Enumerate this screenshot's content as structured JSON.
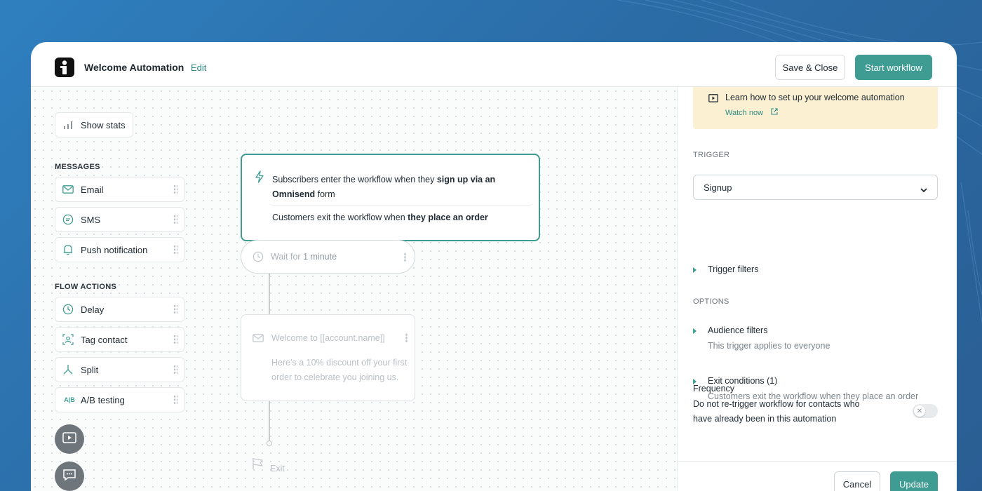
{
  "header": {
    "title": "Welcome Automation",
    "edit_label": "Edit",
    "save_close_label": "Save & Close",
    "start_workflow_label": "Start workflow"
  },
  "sidebar": {
    "show_stats_label": "Show stats",
    "messages_heading": "MESSAGES",
    "messages": [
      {
        "label": "Email",
        "icon": "mail-icon"
      },
      {
        "label": "SMS",
        "icon": "chat-icon"
      },
      {
        "label": "Push notification",
        "icon": "bell-icon"
      }
    ],
    "flow_actions_heading": "FLOW ACTIONS",
    "flow_actions": [
      {
        "label": "Delay",
        "icon": "clock-icon"
      },
      {
        "label": "Tag contact",
        "icon": "tag-contact-icon"
      },
      {
        "label": "Split",
        "icon": "split-icon"
      },
      {
        "label": "A/B testing",
        "icon": "ab-test-icon"
      }
    ]
  },
  "flow": {
    "trigger": {
      "enter_prefix": "Subscribers enter the workflow when they ",
      "enter_bold": "sign up via an Omnisend",
      "enter_suffix": "form",
      "exit_prefix": "Customers exit the workflow when ",
      "exit_bold": "they place an order"
    },
    "wait": {
      "prefix": "Wait for ",
      "value": "1 minute"
    },
    "email": {
      "title": "Welcome to [[account.name]]",
      "body": "Here's a 10% discount off your first order to celebrate you joining us."
    },
    "exit_label": "Exit"
  },
  "panel": {
    "learn_text": "Learn how to set up your welcome automation",
    "watch_label": "Watch now",
    "trigger_heading": "TRIGGER",
    "trigger_value": "Signup",
    "trigger_filters_label": "Trigger filters",
    "options_heading": "OPTIONS",
    "audience_filters_label": "Audience filters",
    "audience_filters_desc": "This trigger applies to everyone",
    "exit_conditions_label": "Exit conditions (1)",
    "exit_conditions_desc": "Customers exit the workflow when they place an order",
    "frequency_title": "Frequency",
    "frequency_desc": "Do not re-trigger workflow for contacts who have already been in this automation",
    "frequency_enabled": false,
    "cancel_label": "Cancel",
    "update_label": "Update"
  },
  "colors": {
    "accent": "#3f9c92",
    "link": "#2b8a84",
    "banner": "#fcf0d2"
  }
}
